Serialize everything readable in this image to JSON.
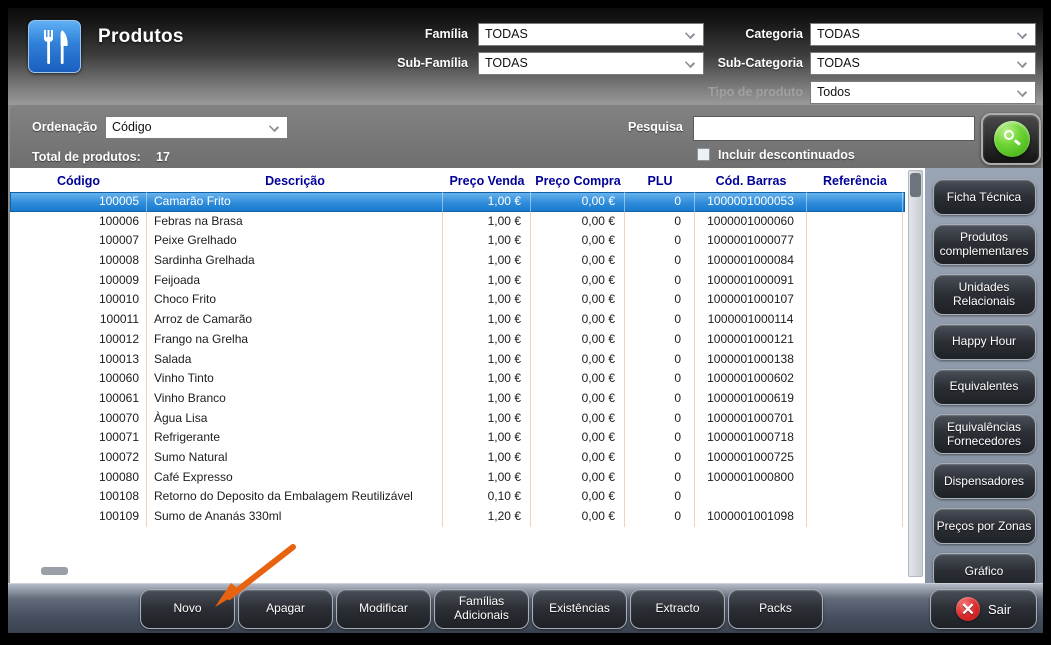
{
  "header": {
    "title": "Produtos",
    "filters": {
      "familia": {
        "label": "Família",
        "value": "TODAS"
      },
      "sub_familia": {
        "label": "Sub-Família",
        "value": "TODAS"
      },
      "categoria": {
        "label": "Categoria",
        "value": "TODAS"
      },
      "sub_categoria": {
        "label": "Sub-Categoria",
        "value": "TODAS"
      },
      "tipo_produto": {
        "label": "Tipo de produto",
        "value": "Todos"
      }
    }
  },
  "toolbar": {
    "ordenacao_label": "Ordenação",
    "ordenacao_value": "Código",
    "total_label": "Total de produtos:",
    "total_value": "17",
    "pesquisa_label": "Pesquisa",
    "pesquisa_value": "",
    "incluir_label": "Incluir descontinuados",
    "incluir_checked": false,
    "search_button_icon": "magnifier-icon"
  },
  "table": {
    "columns": [
      "Código",
      "Descrição",
      "Preço Venda",
      "Preço Compra",
      "PLU",
      "Cód. Barras",
      "Referência"
    ],
    "selected_index": 0,
    "rows": [
      {
        "codigo": "100005",
        "descricao": "Camarão Frito",
        "preco_venda": "1,00 €",
        "preco_compra": "0,00 €",
        "plu": "0",
        "cod_barras": "1000001000053",
        "referencia": ""
      },
      {
        "codigo": "100006",
        "descricao": "Febras na Brasa",
        "preco_venda": "1,00 €",
        "preco_compra": "0,00 €",
        "plu": "0",
        "cod_barras": "1000001000060",
        "referencia": ""
      },
      {
        "codigo": "100007",
        "descricao": "Peixe Grelhado",
        "preco_venda": "1,00 €",
        "preco_compra": "0,00 €",
        "plu": "0",
        "cod_barras": "1000001000077",
        "referencia": ""
      },
      {
        "codigo": "100008",
        "descricao": "Sardinha Grelhada",
        "preco_venda": "1,00 €",
        "preco_compra": "0,00 €",
        "plu": "0",
        "cod_barras": "1000001000084",
        "referencia": ""
      },
      {
        "codigo": "100009",
        "descricao": "Feijoada",
        "preco_venda": "1,00 €",
        "preco_compra": "0,00 €",
        "plu": "0",
        "cod_barras": "1000001000091",
        "referencia": ""
      },
      {
        "codigo": "100010",
        "descricao": "Choco Frito",
        "preco_venda": "1,00 €",
        "preco_compra": "0,00 €",
        "plu": "0",
        "cod_barras": "1000001000107",
        "referencia": ""
      },
      {
        "codigo": "100011",
        "descricao": "Arroz de Camarão",
        "preco_venda": "1,00 €",
        "preco_compra": "0,00 €",
        "plu": "0",
        "cod_barras": "1000001000114",
        "referencia": ""
      },
      {
        "codigo": "100012",
        "descricao": "Frango na Grelha",
        "preco_venda": "1,00 €",
        "preco_compra": "0,00 €",
        "plu": "0",
        "cod_barras": "1000001000121",
        "referencia": ""
      },
      {
        "codigo": "100013",
        "descricao": "Salada",
        "preco_venda": "1,00 €",
        "preco_compra": "0,00 €",
        "plu": "0",
        "cod_barras": "1000001000138",
        "referencia": ""
      },
      {
        "codigo": "100060",
        "descricao": "Vinho Tinto",
        "preco_venda": "1,00 €",
        "preco_compra": "0,00 €",
        "plu": "0",
        "cod_barras": "1000001000602",
        "referencia": ""
      },
      {
        "codigo": "100061",
        "descricao": "Vinho Branco",
        "preco_venda": "1,00 €",
        "preco_compra": "0,00 €",
        "plu": "0",
        "cod_barras": "1000001000619",
        "referencia": ""
      },
      {
        "codigo": "100070",
        "descricao": "Àgua Lisa",
        "preco_venda": "1,00 €",
        "preco_compra": "0,00 €",
        "plu": "0",
        "cod_barras": "1000001000701",
        "referencia": ""
      },
      {
        "codigo": "100071",
        "descricao": "Refrigerante",
        "preco_venda": "1,00 €",
        "preco_compra": "0,00 €",
        "plu": "0",
        "cod_barras": "1000001000718",
        "referencia": ""
      },
      {
        "codigo": "100072",
        "descricao": "Sumo Natural",
        "preco_venda": "1,00 €",
        "preco_compra": "0,00 €",
        "plu": "0",
        "cod_barras": "1000001000725",
        "referencia": ""
      },
      {
        "codigo": "100080",
        "descricao": "Café Expresso",
        "preco_venda": "1,00 €",
        "preco_compra": "0,00 €",
        "plu": "0",
        "cod_barras": "1000001000800",
        "referencia": ""
      },
      {
        "codigo": "100108",
        "descricao": "Retorno do Deposito da Embalagem Reutilizável",
        "preco_venda": "0,10 €",
        "preco_compra": "0,00 €",
        "plu": "0",
        "cod_barras": "",
        "referencia": ""
      },
      {
        "codigo": "100109",
        "descricao": "Sumo de Ananás 330ml",
        "preco_venda": "1,20 €",
        "preco_compra": "0,00 €",
        "plu": "0",
        "cod_barras": "1000001001098",
        "referencia": ""
      }
    ]
  },
  "sidebar": {
    "buttons": [
      {
        "id": "ficha-tecnica",
        "label": "Ficha Técnica"
      },
      {
        "id": "produtos-complementares",
        "label": "Produtos complementares"
      },
      {
        "id": "unidades-relacionais",
        "label": "Unidades Relacionais"
      },
      {
        "id": "happy-hour",
        "label": "Happy Hour"
      },
      {
        "id": "equivalentes",
        "label": "Equivalentes"
      },
      {
        "id": "equivalencias-fornecedores",
        "label": "Equivalências Fornecedores"
      },
      {
        "id": "dispensadores",
        "label": "Dispensadores"
      },
      {
        "id": "precos-por-zonas",
        "label": "Preços por Zonas"
      },
      {
        "id": "grafico",
        "label": "Gráfico"
      }
    ]
  },
  "bottom_bar": {
    "buttons": [
      {
        "id": "novo",
        "label": "Novo"
      },
      {
        "id": "apagar",
        "label": "Apagar"
      },
      {
        "id": "modificar",
        "label": "Modificar"
      },
      {
        "id": "familias-adicionais",
        "label": "Famílias Adicionais"
      },
      {
        "id": "existencias",
        "label": "Existências"
      },
      {
        "id": "extracto",
        "label": "Extracto"
      },
      {
        "id": "packs",
        "label": "Packs"
      }
    ],
    "sair_label": "Sair"
  },
  "annotations": {
    "arrow": {
      "target": "novo-button",
      "color": "#e8630f"
    }
  },
  "colors": {
    "selected_row_blue": "#2f8cda",
    "table_header_text": "#000099",
    "search_orb_green": "#6ed435",
    "exit_red": "#e03030",
    "app_icon_blue": "#2f7fd8",
    "arrow_orange": "#e8630f"
  }
}
